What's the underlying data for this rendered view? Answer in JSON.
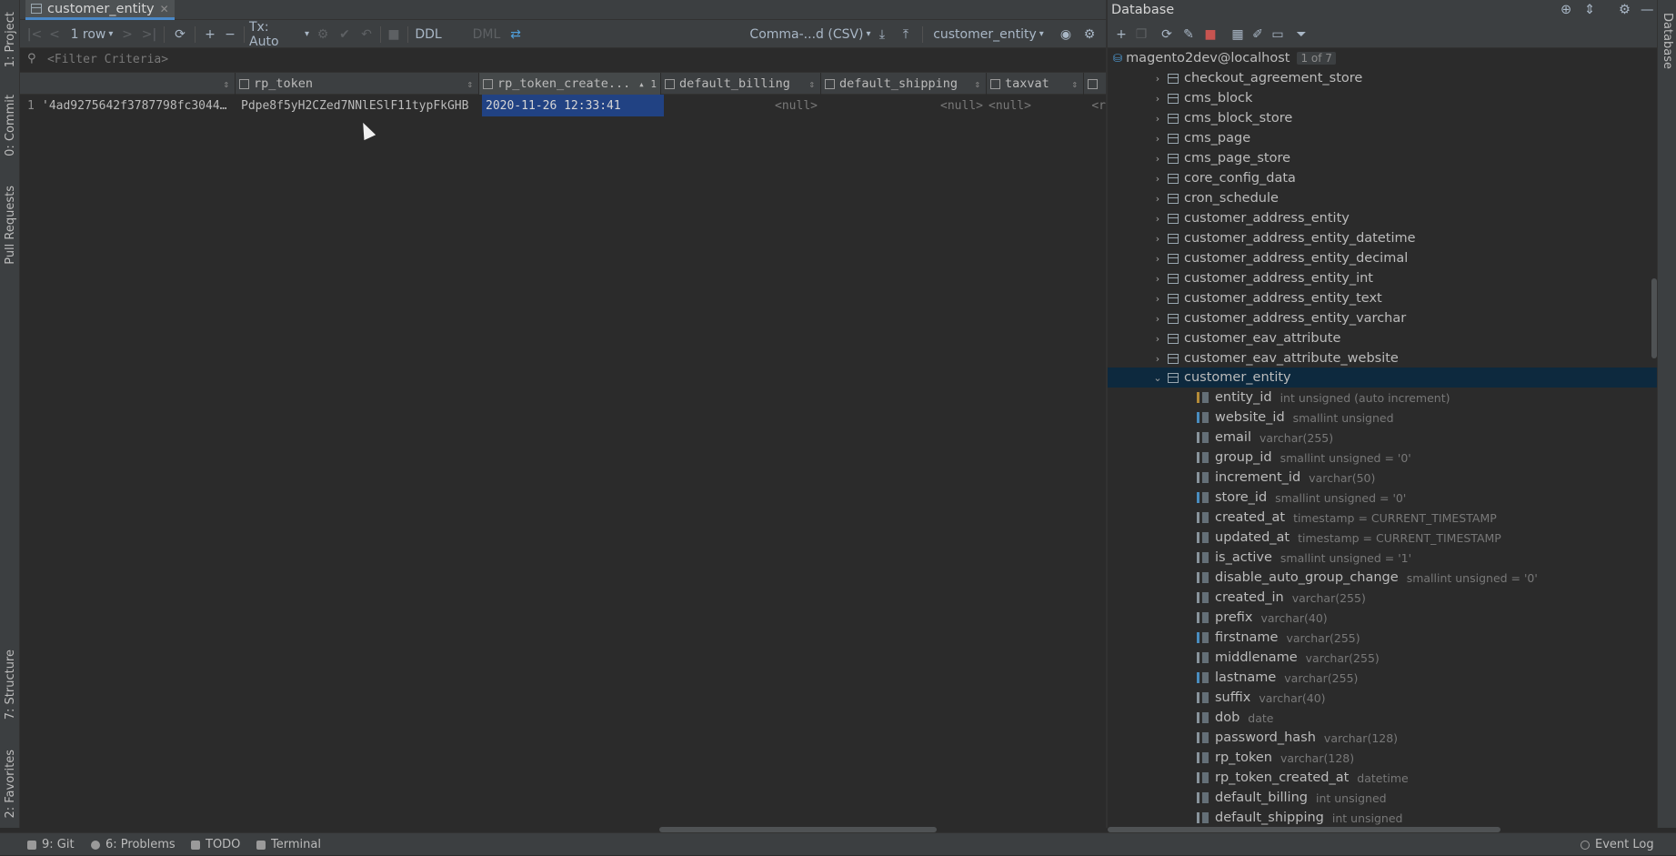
{
  "left_strip": {
    "tabs": [
      "1: Project",
      "0: Commit",
      "Pull Requests",
      "7: Structure",
      "2: Favorites"
    ]
  },
  "right_strip": {
    "tab": "Database"
  },
  "editor": {
    "tab_title": "customer_entity",
    "toolbar": {
      "rows": "1 row",
      "tx": "Tx: Auto",
      "ddl": "DDL",
      "dml": "DML",
      "export_format": "Comma-...d (CSV)",
      "table_selector": "customer_entity"
    },
    "filter_placeholder": "<Filter Criteria>",
    "columns": [
      {
        "label": "",
        "sort": ""
      },
      {
        "label": "rp_token",
        "sort": ""
      },
      {
        "label": "rp_token_create...",
        "sort": "1"
      },
      {
        "label": "default_billing",
        "sort": ""
      },
      {
        "label": "default_shipping",
        "sort": ""
      },
      {
        "label": "taxvat",
        "sort": ""
      },
      {
        "label": "",
        "sort": ""
      }
    ],
    "row": {
      "num": "1",
      "password_hash": "'4ad9275642f3787798fc3044…",
      "rp_token": "Pdpe8f5yH2CZed7NNlESlF11typFkGHB",
      "rp_token_created_at": "2020-11-26 12:33:41",
      "default_billing": "<null>",
      "default_shipping": "<null>",
      "taxvat": "<null>",
      "extra": "<r"
    }
  },
  "db": {
    "title": "Database",
    "connection": "magento2dev@localhost",
    "connection_badge": "1 of 7",
    "tables": [
      "checkout_agreement_store",
      "cms_block",
      "cms_block_store",
      "cms_page",
      "cms_page_store",
      "core_config_data",
      "cron_schedule",
      "customer_address_entity",
      "customer_address_entity_datetime",
      "customer_address_entity_decimal",
      "customer_address_entity_int",
      "customer_address_entity_text",
      "customer_address_entity_varchar",
      "customer_eav_attribute",
      "customer_eav_attribute_website"
    ],
    "expanded_table": "customer_entity",
    "columns": [
      {
        "name": "entity_id",
        "type": "int unsigned (auto increment)",
        "kind": "key"
      },
      {
        "name": "website_id",
        "type": "smallint unsigned",
        "kind": "idx"
      },
      {
        "name": "email",
        "type": "varchar(255)",
        "kind": "col"
      },
      {
        "name": "group_id",
        "type": "smallint unsigned = '0'",
        "kind": "col"
      },
      {
        "name": "increment_id",
        "type": "varchar(50)",
        "kind": "col"
      },
      {
        "name": "store_id",
        "type": "smallint unsigned = '0'",
        "kind": "idx"
      },
      {
        "name": "created_at",
        "type": "timestamp = CURRENT_TIMESTAMP",
        "kind": "col"
      },
      {
        "name": "updated_at",
        "type": "timestamp = CURRENT_TIMESTAMP",
        "kind": "col"
      },
      {
        "name": "is_active",
        "type": "smallint unsigned = '1'",
        "kind": "col"
      },
      {
        "name": "disable_auto_group_change",
        "type": "smallint unsigned = '0'",
        "kind": "col"
      },
      {
        "name": "created_in",
        "type": "varchar(255)",
        "kind": "col"
      },
      {
        "name": "prefix",
        "type": "varchar(40)",
        "kind": "col"
      },
      {
        "name": "firstname",
        "type": "varchar(255)",
        "kind": "idx"
      },
      {
        "name": "middlename",
        "type": "varchar(255)",
        "kind": "col"
      },
      {
        "name": "lastname",
        "type": "varchar(255)",
        "kind": "idx"
      },
      {
        "name": "suffix",
        "type": "varchar(40)",
        "kind": "col"
      },
      {
        "name": "dob",
        "type": "date",
        "kind": "col"
      },
      {
        "name": "password_hash",
        "type": "varchar(128)",
        "kind": "col"
      },
      {
        "name": "rp_token",
        "type": "varchar(128)",
        "kind": "col"
      },
      {
        "name": "rp_token_created_at",
        "type": "datetime",
        "kind": "col"
      },
      {
        "name": "default_billing",
        "type": "int unsigned",
        "kind": "col"
      },
      {
        "name": "default_shipping",
        "type": "int unsigned",
        "kind": "col"
      }
    ]
  },
  "status": {
    "git": "9: Git",
    "problems": "6: Problems",
    "todo": "TODO",
    "terminal": "Terminal",
    "event_log": "Event Log"
  }
}
